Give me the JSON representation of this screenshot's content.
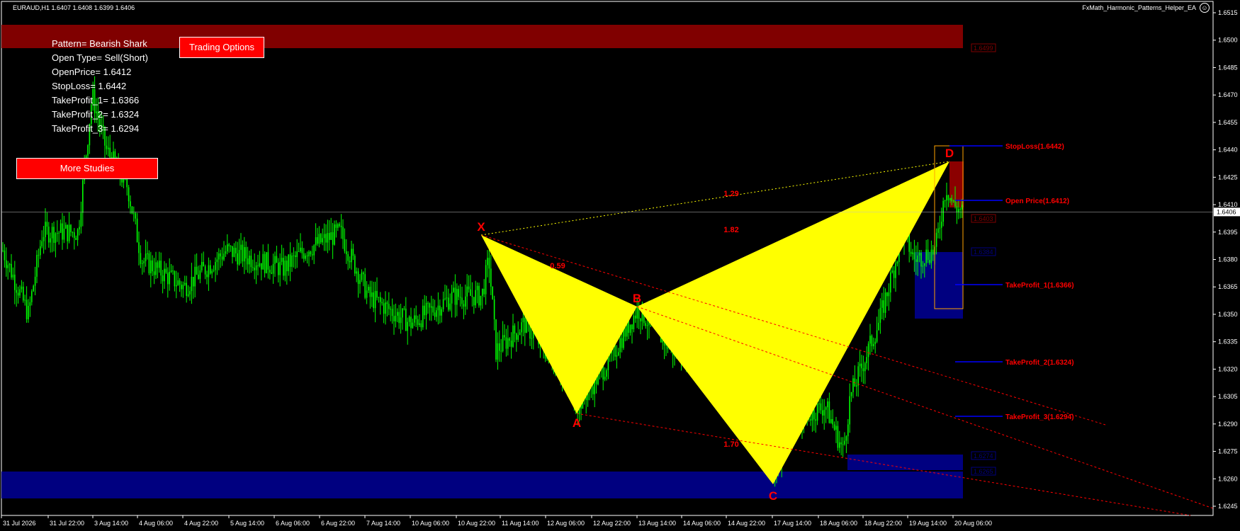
{
  "header": {
    "symbol_line": "EURAUD,H1  1.6407 1.6408 1.6399 1.6406",
    "ea_name": "FxMath_Harmonic_Patterns_Helper_EA",
    "smiley_icon": "smiley-icon"
  },
  "info_panel": {
    "pattern": "Pattern= Bearish Shark",
    "open_type": "Open Type= Sell(Short)",
    "open_price": "OpenPrice= 1.6412",
    "stop_loss": "StopLoss= 1.6442",
    "tp1": "TakeProfit_1= 1.6366",
    "tp2": "TakeProfit_2= 1.6324",
    "tp3": "TakeProfit_3= 1.6294"
  },
  "buttons": {
    "trading_options": "Trading Options",
    "more_studies": "More Studies"
  },
  "colors": {
    "background": "#000000",
    "candles": "#00ff00",
    "pattern_fill": "#ffff00",
    "supply_zone": "#800000",
    "demand_zone": "#000080",
    "label_red": "#ff0000",
    "level_line": "#0000ff"
  },
  "chart_data": {
    "type": "candlestick",
    "symbol": "EURAUD",
    "timeframe": "H1",
    "current_price": "1.6406",
    "ylim": [
      1.6237,
      1.652
    ],
    "price_axis_ticks": [
      "1.6515",
      "1.6500",
      "1.6485",
      "1.6470",
      "1.6455",
      "1.6440",
      "1.6425",
      "1.6410",
      "1.6395",
      "1.6380",
      "1.6365",
      "1.6350",
      "1.6335",
      "1.6320",
      "1.6305",
      "1.6290",
      "1.6275",
      "1.6260",
      "1.6245"
    ],
    "time_axis_ticks": [
      "31 Jul 2026",
      "31 Jul 22:00",
      "3 Aug 14:00",
      "4 Aug 06:00",
      "4 Aug 22:00",
      "5 Aug 14:00",
      "6 Aug 06:00",
      "6 Aug 22:00",
      "7 Aug 14:00",
      "10 Aug 06:00",
      "10 Aug 22:00",
      "11 Aug 14:00",
      "12 Aug 06:00",
      "12 Aug 22:00",
      "13 Aug 14:00",
      "14 Aug 06:00",
      "14 Aug 22:00",
      "17 Aug 14:00",
      "18 Aug 06:00",
      "18 Aug 22:00",
      "19 Aug 14:00",
      "20 Aug 06:00"
    ],
    "pattern": {
      "name": "Bearish Shark",
      "points": [
        {
          "label": "X",
          "price": 1.6395
        },
        {
          "label": "A",
          "price": 1.63
        },
        {
          "label": "B",
          "price": 1.6353
        },
        {
          "label": "C",
          "price": 1.6259
        },
        {
          "label": "D",
          "price": 1.6435
        }
      ],
      "ratios": [
        "0.59",
        "1.82",
        "1.29",
        "1.70"
      ]
    },
    "level_labels": {
      "stop_loss": "StopLoss(1.6442)",
      "open_price": "Open Price(1.6412)",
      "tp1": "TakeProfit_1(1.6366)",
      "tp2": "TakeProfit_2(1.6324)",
      "tp3": "TakeProfit_3(1.6294)"
    },
    "zone_tags": [
      "1.6499",
      "1.6403",
      "1.6384",
      "1.6274",
      "1.6265"
    ],
    "candles_seed": 7
  }
}
